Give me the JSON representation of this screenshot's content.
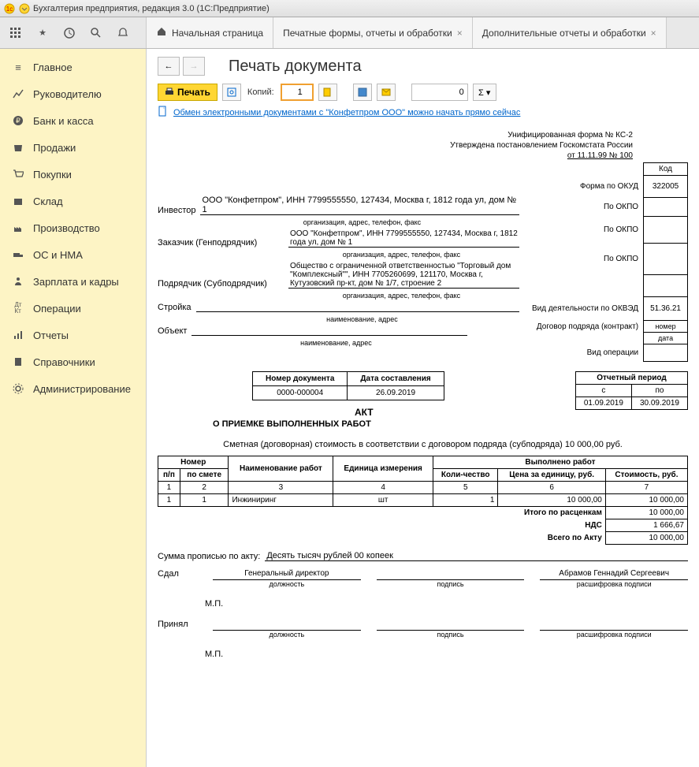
{
  "titlebar": "Бухгалтерия предприятия, редакция 3.0  (1С:Предприятие)",
  "tabs": {
    "home": "Начальная страница",
    "t1": "Печатные формы, отчеты и обработки",
    "t2": "Дополнительные отчеты и обработки"
  },
  "sidebar": [
    "Главное",
    "Руководителю",
    "Банк и касса",
    "Продажи",
    "Покупки",
    "Склад",
    "Производство",
    "ОС и НМА",
    "Зарплата и кадры",
    "Операции",
    "Отчеты",
    "Справочники",
    "Администрирование"
  ],
  "page": {
    "title": "Печать документа",
    "print": "Печать",
    "copies_label": "Копий:",
    "copies": "1",
    "zero": "0",
    "link": "Обмен электронными документами с \"Конфетпром ООО\" можно начать прямо сейчас"
  },
  "doc": {
    "form_line1": "Унифицированная форма № КС-2",
    "form_line2": "Утверждена постановлением  Госкомстата России",
    "form_line3": "от 11.11.99 № 100",
    "code_head": "Код",
    "okud_label": "Форма по ОКУД",
    "okud": "322005",
    "okpo_label": "По ОКПО",
    "okved_label": "Вид деятельности по ОКВЭД",
    "okved": "51.36.21",
    "contract_label": "Договор подряда (контракт)",
    "contract_num_label": "номер",
    "contract_date_label": "дата",
    "operation_label": "Вид операции",
    "investor_label": "Инвестор",
    "investor": "ООО \"Конфетпром\", ИНН 7799555550, 127434, Москва г, 1812 года ул, дом № 1",
    "customer_label": "Заказчик (Генподрядчик)",
    "customer": "ООО \"Конфетпром\", ИНН 7799555550, 127434, Москва г, 1812 года ул, дом № 1",
    "contractor_label": "Подрядчик (Субподрядчик)",
    "contractor": "Общество с ограниченной ответственностью \"Торговый дом \"Комплексный\"\", ИНН 7705260699, 121170, Москва г, Кутузовский пр-кт, дом № 1/7, строение 2",
    "org_sub": "организация, адрес, телефон, факс",
    "stroyka_label": "Стройка",
    "stroyka_sub": "наименование, адрес",
    "object_label": "Объект",
    "object_sub": "наименование, адрес",
    "doc_num_h1": "Номер документа",
    "doc_num_h2": "Дата составления",
    "doc_num": "0000-000004",
    "doc_date": "26.09.2019",
    "act": "АКТ",
    "act_sub": "О ПРИЕМКЕ ВЫПОЛНЕННЫХ РАБОТ",
    "period_head": "Отчетный период",
    "period_from_h": "с",
    "period_to_h": "по",
    "period_from": "01.09.2019",
    "period_to": "30.09.2019",
    "smeta": "Сметная (договорная) стоимость в соответствии с договором подряда (субподряда) 10 000,00 руб.",
    "th_num": "Номер",
    "th_pp": "п/п",
    "th_smete": "по смете",
    "th_name": "Наименование работ",
    "th_unit": "Единица измерения",
    "th_done": "Выполнено работ",
    "th_qty": "Коли-чество",
    "th_price": "Цена за единицу, руб.",
    "th_cost": "Стоимость, руб.",
    "row": {
      "pp": "1",
      "smete": "1",
      "name": "Инжиниринг",
      "unit": "шт",
      "qty": "1",
      "price": "10 000,00",
      "cost": "10 000,00"
    },
    "total1_label": "Итого по расценкам",
    "total1": "10 000,00",
    "nds_label": "НДС",
    "nds": "1 666,67",
    "total2_label": "Всего по Акту",
    "total2": "10 000,00",
    "sum_words_label": "Сумма прописью по акту:",
    "sum_words": "Десять тысяч рублей 00 копеек",
    "sdal": "Сдал",
    "sdal_pos": "Генеральный директор",
    "sdal_name": "Абрамов Геннадий Сергеевич",
    "prinyal": "Принял",
    "sig_pos": "должность",
    "sig_sign": "подпись",
    "sig_dec": "расшифровка подписи",
    "mp": "М.П."
  }
}
